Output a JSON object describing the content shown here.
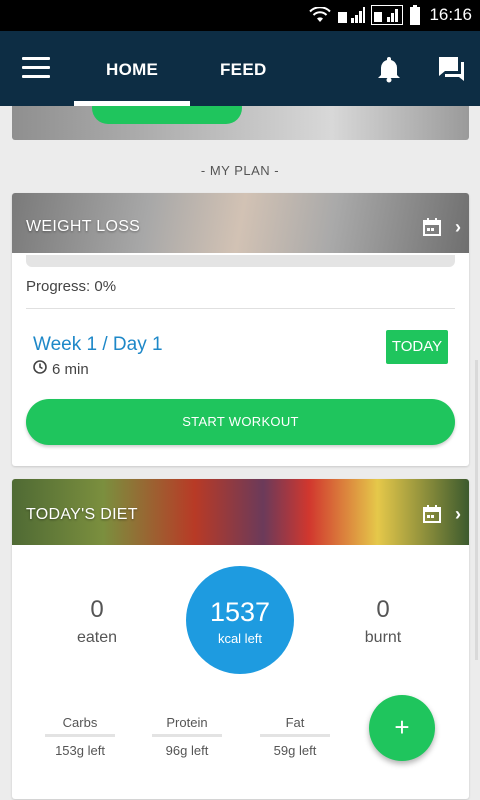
{
  "status_bar": {
    "time": "16:16",
    "icons": [
      "wifi-icon",
      "signal-icon",
      "signal-2-icon",
      "battery-icon"
    ]
  },
  "app_bar": {
    "tabs": [
      {
        "label": "HOME",
        "active": true
      },
      {
        "label": "FEED",
        "active": false
      }
    ],
    "icons": [
      "menu-icon",
      "bell-icon",
      "chat-icon"
    ]
  },
  "plan": {
    "section_label": "- MY PLAN -",
    "weight_loss": {
      "title": "WEIGHT LOSS",
      "progress_label": "Progress: 0%",
      "progress": 0,
      "week_day": "Week 1 / Day 1",
      "duration": "6 min",
      "today_badge": "TODAY",
      "start_button": "START WORKOUT"
    }
  },
  "diet": {
    "title": "TODAY'S DIET",
    "eaten": {
      "value": "0",
      "label": "eaten"
    },
    "kcal": {
      "value": "1537",
      "label": "kcal left"
    },
    "burnt": {
      "value": "0",
      "label": "burnt"
    },
    "macros": [
      {
        "name": "Carbs",
        "left": "153g left"
      },
      {
        "name": "Protein",
        "left": "96g left"
      },
      {
        "name": "Fat",
        "left": "59g left"
      }
    ],
    "fab_label": "+"
  },
  "colors": {
    "primary_dark": "#0d2d44",
    "accent_green": "#1fc55d",
    "accent_blue": "#1e9be0",
    "link_blue": "#1e88c8"
  }
}
